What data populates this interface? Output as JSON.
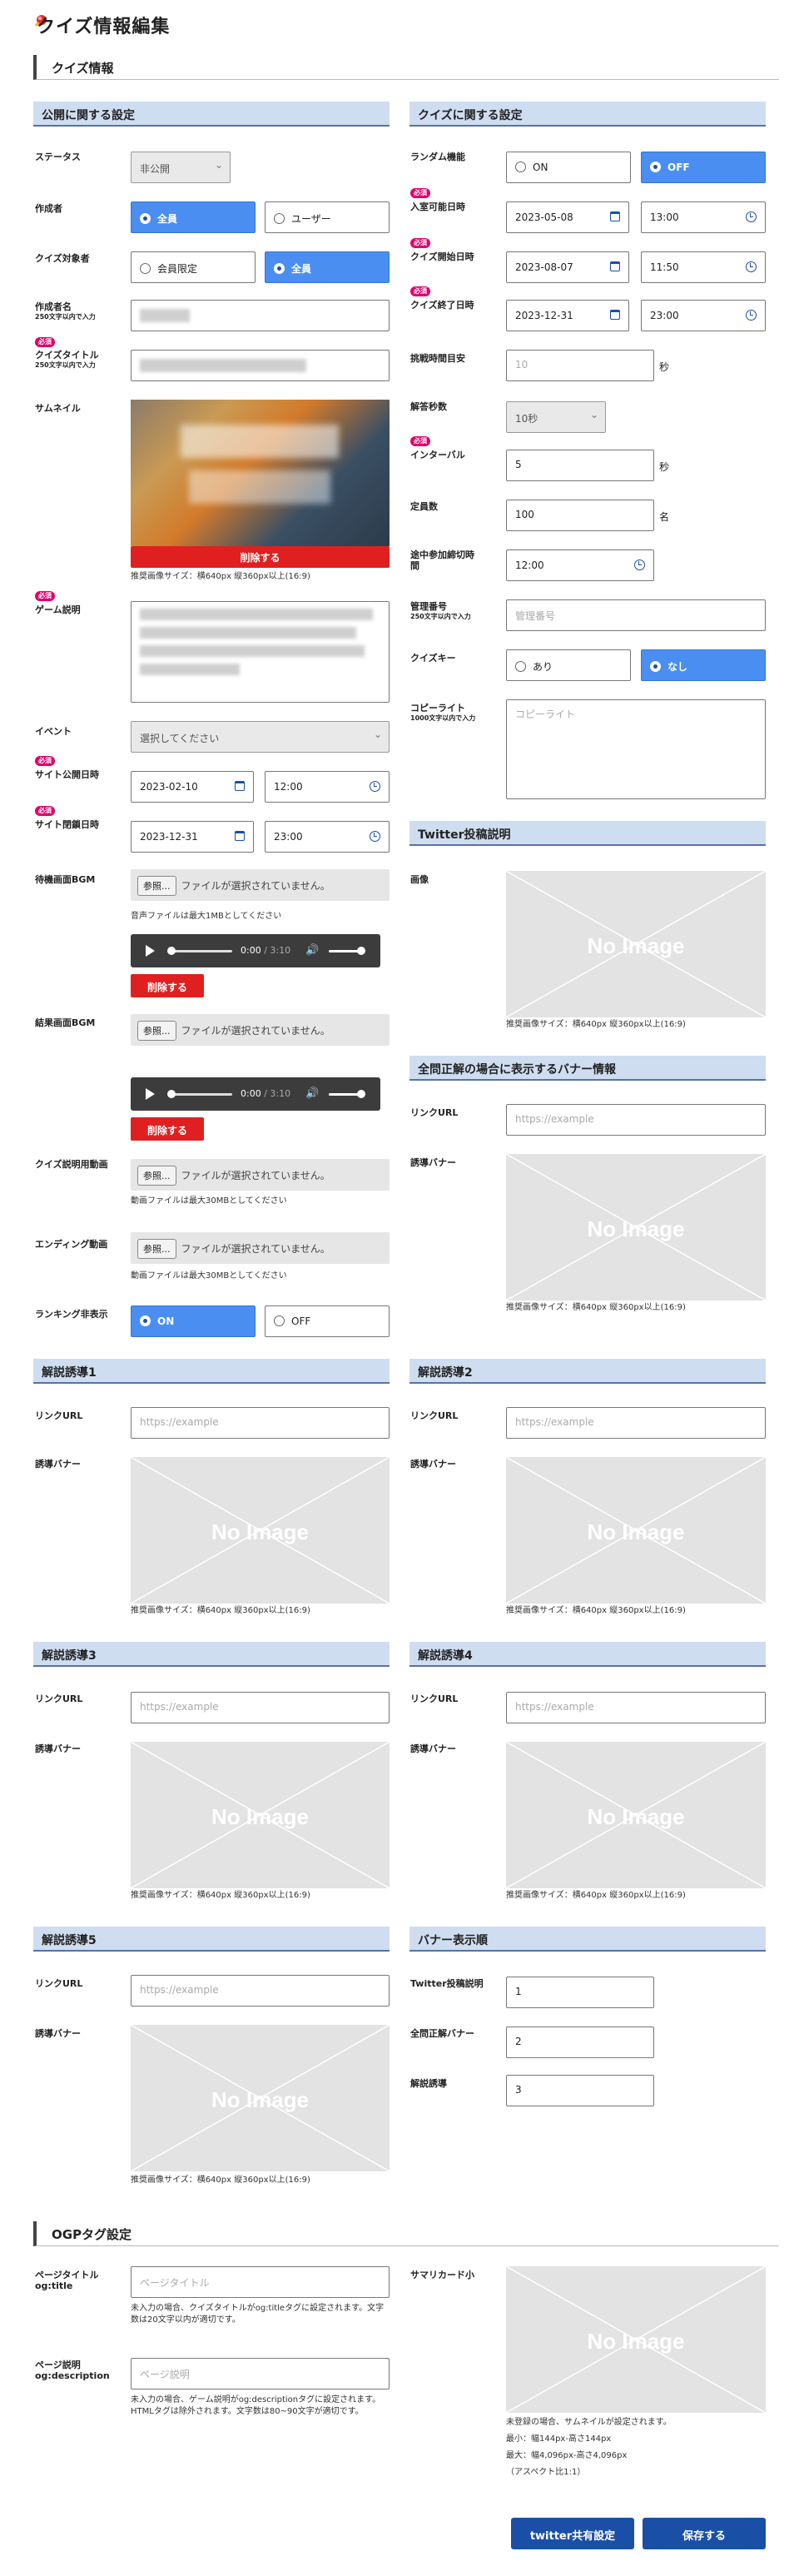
{
  "page": {
    "title": "クイズ情報編集"
  },
  "sections": {
    "quiz_info": "クイズ情報",
    "ogp": "OGPタグ設定"
  },
  "required_label": "必須",
  "public": {
    "header": "公開に関する設定",
    "status": {
      "label": "ステータス",
      "value": "非公開"
    },
    "author": {
      "label": "作成者",
      "options": [
        "全員",
        "ユーザー"
      ],
      "selected": "全員"
    },
    "target": {
      "label": "クイズ対象者",
      "options": [
        "会員限定",
        "全員"
      ],
      "selected": "全員"
    },
    "author_name": {
      "label": "作成者名",
      "note": "250文字以内で入力"
    },
    "quiz_title": {
      "label": "クイズタイトル",
      "note": "250文字以内で入力"
    },
    "thumbnail": {
      "label": "サムネイル",
      "delete": "削除する",
      "note": "推奨画像サイズ：横640px 縦360px以上(16:9)"
    },
    "game_desc": {
      "label": "ゲーム説明"
    },
    "event": {
      "label": "イベント",
      "value": "選択してください"
    },
    "open_date": {
      "label": "サイト公開日時",
      "date": "2023-02-10",
      "time": "12:00"
    },
    "close_date": {
      "label": "サイト閉鎖日時",
      "date": "2023-12-31",
      "time": "23:00"
    },
    "wait_bgm": {
      "label": "待機画面BGM",
      "button": "参照...",
      "file": "ファイルが選択されていません。",
      "note": "音声ファイルは最大1MBとしてください",
      "time": "0:00",
      "duration": "3:10",
      "delete": "削除する"
    },
    "result_bgm": {
      "label": "結果画面BGM",
      "button": "参照...",
      "file": "ファイルが選択されていません。",
      "time": "0:00",
      "duration": "3:10",
      "delete": "削除する"
    },
    "desc_video": {
      "label": "クイズ説明用動画",
      "button": "参照...",
      "file": "ファイルが選択されていません。",
      "note": "動画ファイルは最大30MBとしてください"
    },
    "ending_video": {
      "label": "エンディング動画",
      "button": "参照...",
      "file": "ファイルが選択されていません。",
      "note": "動画ファイルは最大30MBとしてください"
    },
    "ranking_hide": {
      "label": "ランキング非表示",
      "options": [
        "ON",
        "OFF"
      ],
      "selected": "ON"
    }
  },
  "quiz": {
    "header": "クイズに関する設定",
    "random": {
      "label": "ランダム機能",
      "options": [
        "ON",
        "OFF"
      ],
      "selected": "OFF"
    },
    "entry": {
      "label": "入室可能日時",
      "date": "2023-05-08",
      "time": "13:00"
    },
    "start": {
      "label": "クイズ開始日時",
      "date": "2023-08-07",
      "time": "11:50"
    },
    "end": {
      "label": "クイズ終了日時",
      "date": "2023-12-31",
      "time": "23:00"
    },
    "challenge": {
      "label": "挑戦時間目安",
      "placeholder": "10",
      "unit": "秒"
    },
    "answer_sec": {
      "label": "解答秒数",
      "value": "10秒"
    },
    "interval": {
      "label": "インターバル",
      "value": "5",
      "unit": "秒"
    },
    "capacity": {
      "label": "定員数",
      "value": "100",
      "unit": "名"
    },
    "late_join": {
      "label": "途中参加締切時間",
      "value": "12:00"
    },
    "manage_no": {
      "label": "管理番号",
      "note": "250文字以内で入力",
      "placeholder": "管理番号"
    },
    "quiz_key": {
      "label": "クイズキー",
      "options": [
        "あり",
        "なし"
      ],
      "selected": "なし"
    },
    "copyright": {
      "label": "コピーライト",
      "note": "1000文字以内で入力",
      "placeholder": "コピーライト"
    }
  },
  "twitter": {
    "header": "Twitter投稿説明",
    "image_label": "画像",
    "no_image": "No Image",
    "note": "推奨画像サイズ：横640px 縦360px以上(16:9)"
  },
  "banner": {
    "header": "全問正解の場合に表示するバナー情報",
    "link_label": "リンクURL",
    "link_placeholder": "https://example",
    "banner_label": "誘導バナー",
    "no_image": "No Image",
    "note": "推奨画像サイズ：横640px 縦360px以上(16:9)"
  },
  "guides": [
    {
      "header": "解説誘導1",
      "link_label": "リンクURL",
      "placeholder": "https://example",
      "banner_label": "誘導バナー",
      "no_image": "No Image",
      "note": "推奨画像サイズ：横640px 縦360px以上(16:9)"
    },
    {
      "header": "解説誘導2",
      "link_label": "リンクURL",
      "placeholder": "https://example",
      "banner_label": "誘導バナー",
      "no_image": "No Image",
      "note": "推奨画像サイズ：横640px 縦360px以上(16:9)"
    },
    {
      "header": "解説誘導3",
      "link_label": "リンクURL",
      "placeholder": "https://example",
      "banner_label": "誘導バナー",
      "no_image": "No Image",
      "note": "推奨画像サイズ：横640px 縦360px以上(16:9)"
    },
    {
      "header": "解説誘導4",
      "link_label": "リンクURL",
      "placeholder": "https://example",
      "banner_label": "誘導バナー",
      "no_image": "No Image",
      "note": "推奨画像サイズ：横640px 縦360px以上(16:9)"
    },
    {
      "header": "解説誘導5",
      "link_label": "リンクURL",
      "placeholder": "https://example",
      "banner_label": "誘導バナー",
      "no_image": "No Image",
      "note": "推奨画像サイズ：横640px 縦360px以上(16:9)"
    }
  ],
  "banner_order": {
    "header": "バナー表示順",
    "rows": [
      {
        "label": "Twitter投稿説明",
        "value": "1"
      },
      {
        "label": "全問正解バナー",
        "value": "2"
      },
      {
        "label": "解説誘導",
        "value": "3"
      }
    ]
  },
  "ogp": {
    "title_label": "ページタイトル",
    "title_label2": "og:title",
    "title_placeholder": "ページタイトル",
    "title_note": "未入力の場合、クイズタイトルがog:titleタグに設定されます。文字数は20文字以内が適切です。",
    "desc_label": "ページ説明",
    "desc_label2": "og:description",
    "desc_placeholder": "ページ説明",
    "desc_note": "未入力の場合、ゲーム説明がog:descriptionタグに設定されます。HTMLタグは除外されます。文字数は80~90文字が適切です。",
    "card_label": "サマリカード小",
    "no_image": "No Image",
    "card_note1": "未登録の場合、サムネイルが設定されます。",
    "card_note2": "最小：幅144px-高さ144px",
    "card_note3": "最大：幅4,096px-高さ4,096px",
    "card_note4": "（アスペクト比1:1）"
  },
  "buttons": {
    "twitter": "twitter共有設定",
    "save": "保存する"
  }
}
